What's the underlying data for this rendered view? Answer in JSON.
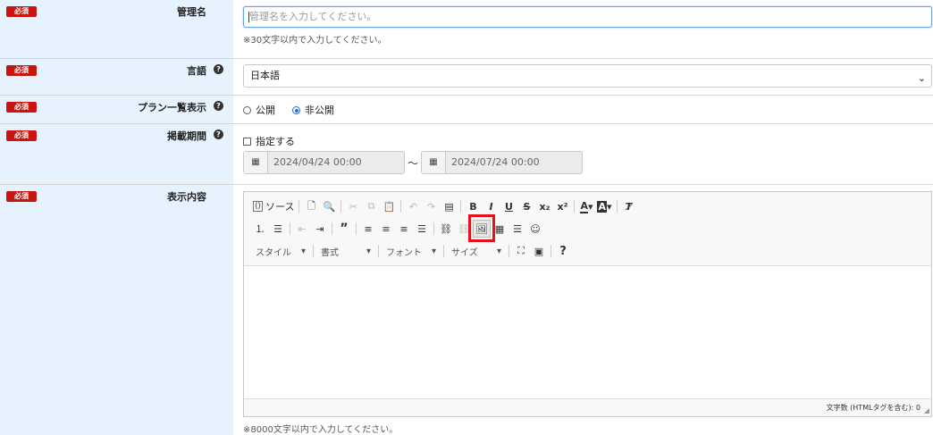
{
  "fields": {
    "name": {
      "badge": "必須",
      "label": "管理名",
      "placeholder": "管理名を入力してください。",
      "note": "※30文字以内で入力してください。"
    },
    "language": {
      "badge": "必須",
      "label": "言語",
      "selected": "日本語"
    },
    "plan_list": {
      "badge": "必須",
      "label": "プラン一覧表示",
      "options": [
        "公開",
        "非公開"
      ],
      "selected": "非公開"
    },
    "period": {
      "badge": "必須",
      "label": "掲載期間",
      "checkbox_label": "指定する",
      "start": "2024/04/24 00:00",
      "end": "2024/07/24 00:00",
      "separator": "〜"
    },
    "content": {
      "badge": "必須",
      "label": "表示内容",
      "note": "※8000文字以内で入力してください。"
    }
  },
  "editor": {
    "source_label": "ソース",
    "combos": [
      "スタイル",
      "書式",
      "フォント",
      "サイズ"
    ],
    "footer": "文字数 (HTMLタグを含む): 0",
    "toolbar_row1": [
      "B",
      "I",
      "U",
      "S",
      "x₂",
      "x²"
    ],
    "icons": [
      "source-icon",
      "new-page-icon",
      "preview-icon",
      "cut-icon",
      "copy-icon",
      "paste-icon",
      "undo-icon",
      "redo-icon",
      "paste-text-icon",
      "bold-icon",
      "italic-icon",
      "underline-icon",
      "strike-icon",
      "subscript-icon",
      "superscript-icon",
      "text-color-icon",
      "bg-color-icon",
      "remove-format-icon",
      "numbered-list-icon",
      "bulleted-list-icon",
      "outdent-icon",
      "indent-icon",
      "blockquote-icon",
      "align-left-icon",
      "align-center-icon",
      "align-right-icon",
      "justify-icon",
      "link-icon",
      "unlink-icon",
      "image-icon",
      "table-icon",
      "horizontal-line-icon",
      "smiley-icon",
      "maximize-icon",
      "show-blocks-icon",
      "help-icon"
    ]
  },
  "colors": {
    "label_bg": "#e6f3fe",
    "badge": "#c9150f",
    "highlight": "#e0141a",
    "focus": "#6aa4e0"
  }
}
